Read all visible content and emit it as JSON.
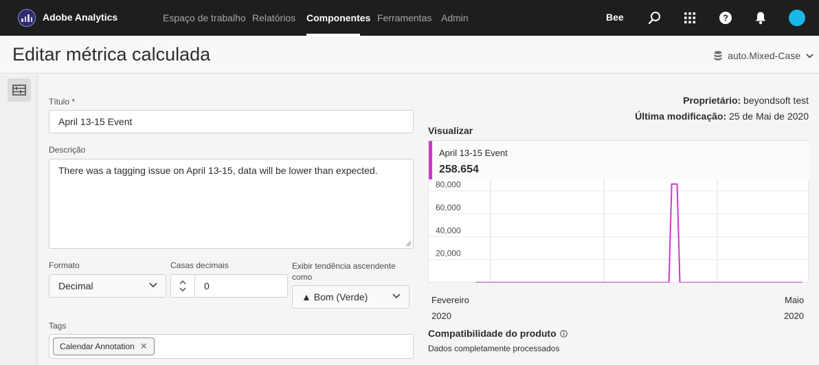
{
  "app": {
    "name": "Adobe Analytics",
    "org": "Bee"
  },
  "nav": {
    "items": [
      "Espaço de trabalho",
      "Relatórios",
      "Componentes",
      "Ferramentas",
      "Admin"
    ],
    "active": "Componentes"
  },
  "header": {
    "title": "Editar métrica calculada",
    "report_suite": "auto.Mixed-Case"
  },
  "form": {
    "title_label": "Título *",
    "title_value": "April 13-15 Event",
    "description_label": "Descrição",
    "description_value": "There was a tagging issue on April 13-15, data will be lower than expected.",
    "format_label": "Formato",
    "format_value": "Decimal",
    "decimals_label": "Casas decimais",
    "decimals_value": "0",
    "trend_label": "Exibir tendência ascendente como",
    "trend_value": "▲ Bom (Verde)",
    "tags_label": "Tags",
    "tags": [
      "Calendar Annotation"
    ]
  },
  "meta": {
    "owner_label": "Proprietário:",
    "owner_value": "beyondsoft test",
    "modified_label": "Última modificação:",
    "modified_value": "25 de Mai de 2020"
  },
  "preview": {
    "label": "Visualizar",
    "metric_name": "April 13-15 Event",
    "metric_total": "258.654",
    "x_start_month": "Fevereiro",
    "x_start_year": "2020",
    "x_end_month": "Maio",
    "x_end_year": "2020"
  },
  "compat": {
    "title": "Compatibilidade do produto",
    "text": "Dados completamente processados"
  },
  "colors": {
    "series": "#c53cc7",
    "nav_bg": "#1e1e1e",
    "avatar": "#18b7ea"
  },
  "chart_data": {
    "type": "line",
    "y_ticks": [
      "20,000",
      "40,000",
      "60,000",
      "80,000"
    ],
    "ylim": [
      0,
      90000
    ],
    "x_start": "2020-02-01",
    "x_end": "2020-05-31",
    "series": [
      {
        "name": "April 13-15 Event",
        "points": [
          [
            "2020-02-01",
            0
          ],
          [
            "2020-04-12",
            0
          ],
          [
            "2020-04-13",
            86000
          ],
          [
            "2020-04-15",
            86000
          ],
          [
            "2020-04-16",
            0
          ],
          [
            "2020-05-31",
            0
          ]
        ]
      }
    ],
    "grid": true
  }
}
